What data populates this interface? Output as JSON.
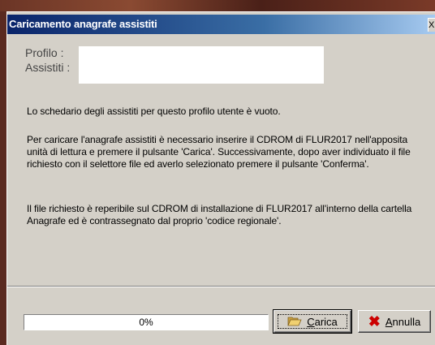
{
  "window": {
    "title": "Caricamento anagrafe assistiti",
    "close_label": "X"
  },
  "fields": {
    "profile_label": "Profilo :",
    "assistiti_label": "Assistiti :"
  },
  "message": {
    "p1": "Lo schedario degli assistiti per questo profilo utente è vuoto.",
    "p2": "Per caricare l'anagrafe assistiti è necessario inserire il CDROM di FLUR2017 nell'apposita unità di lettura e premere il pulsante 'Carica'. Successivamente, dopo aver individuato il file richiesto con il selettore file ed averlo selezionato premere il pulsante 'Conferma'.",
    "p3": "Il file richiesto è reperibile sul CDROM di installazione di FLUR2017 all'interno della cartella Anagrafe ed è contrassegnato dal proprio 'codice regionale'."
  },
  "progress": {
    "value": 0,
    "label": "0%"
  },
  "buttons": {
    "carica_label": "Carica",
    "carica_icon": "folder-open-icon",
    "annulla_label": "Annulla",
    "annulla_icon": "red-x-icon"
  },
  "colors": {
    "titlebar_start": "#0a246a",
    "titlebar_end": "#a6caf0",
    "dialog_bg": "#d4d0c8",
    "cancel_icon": "#cc0000"
  }
}
